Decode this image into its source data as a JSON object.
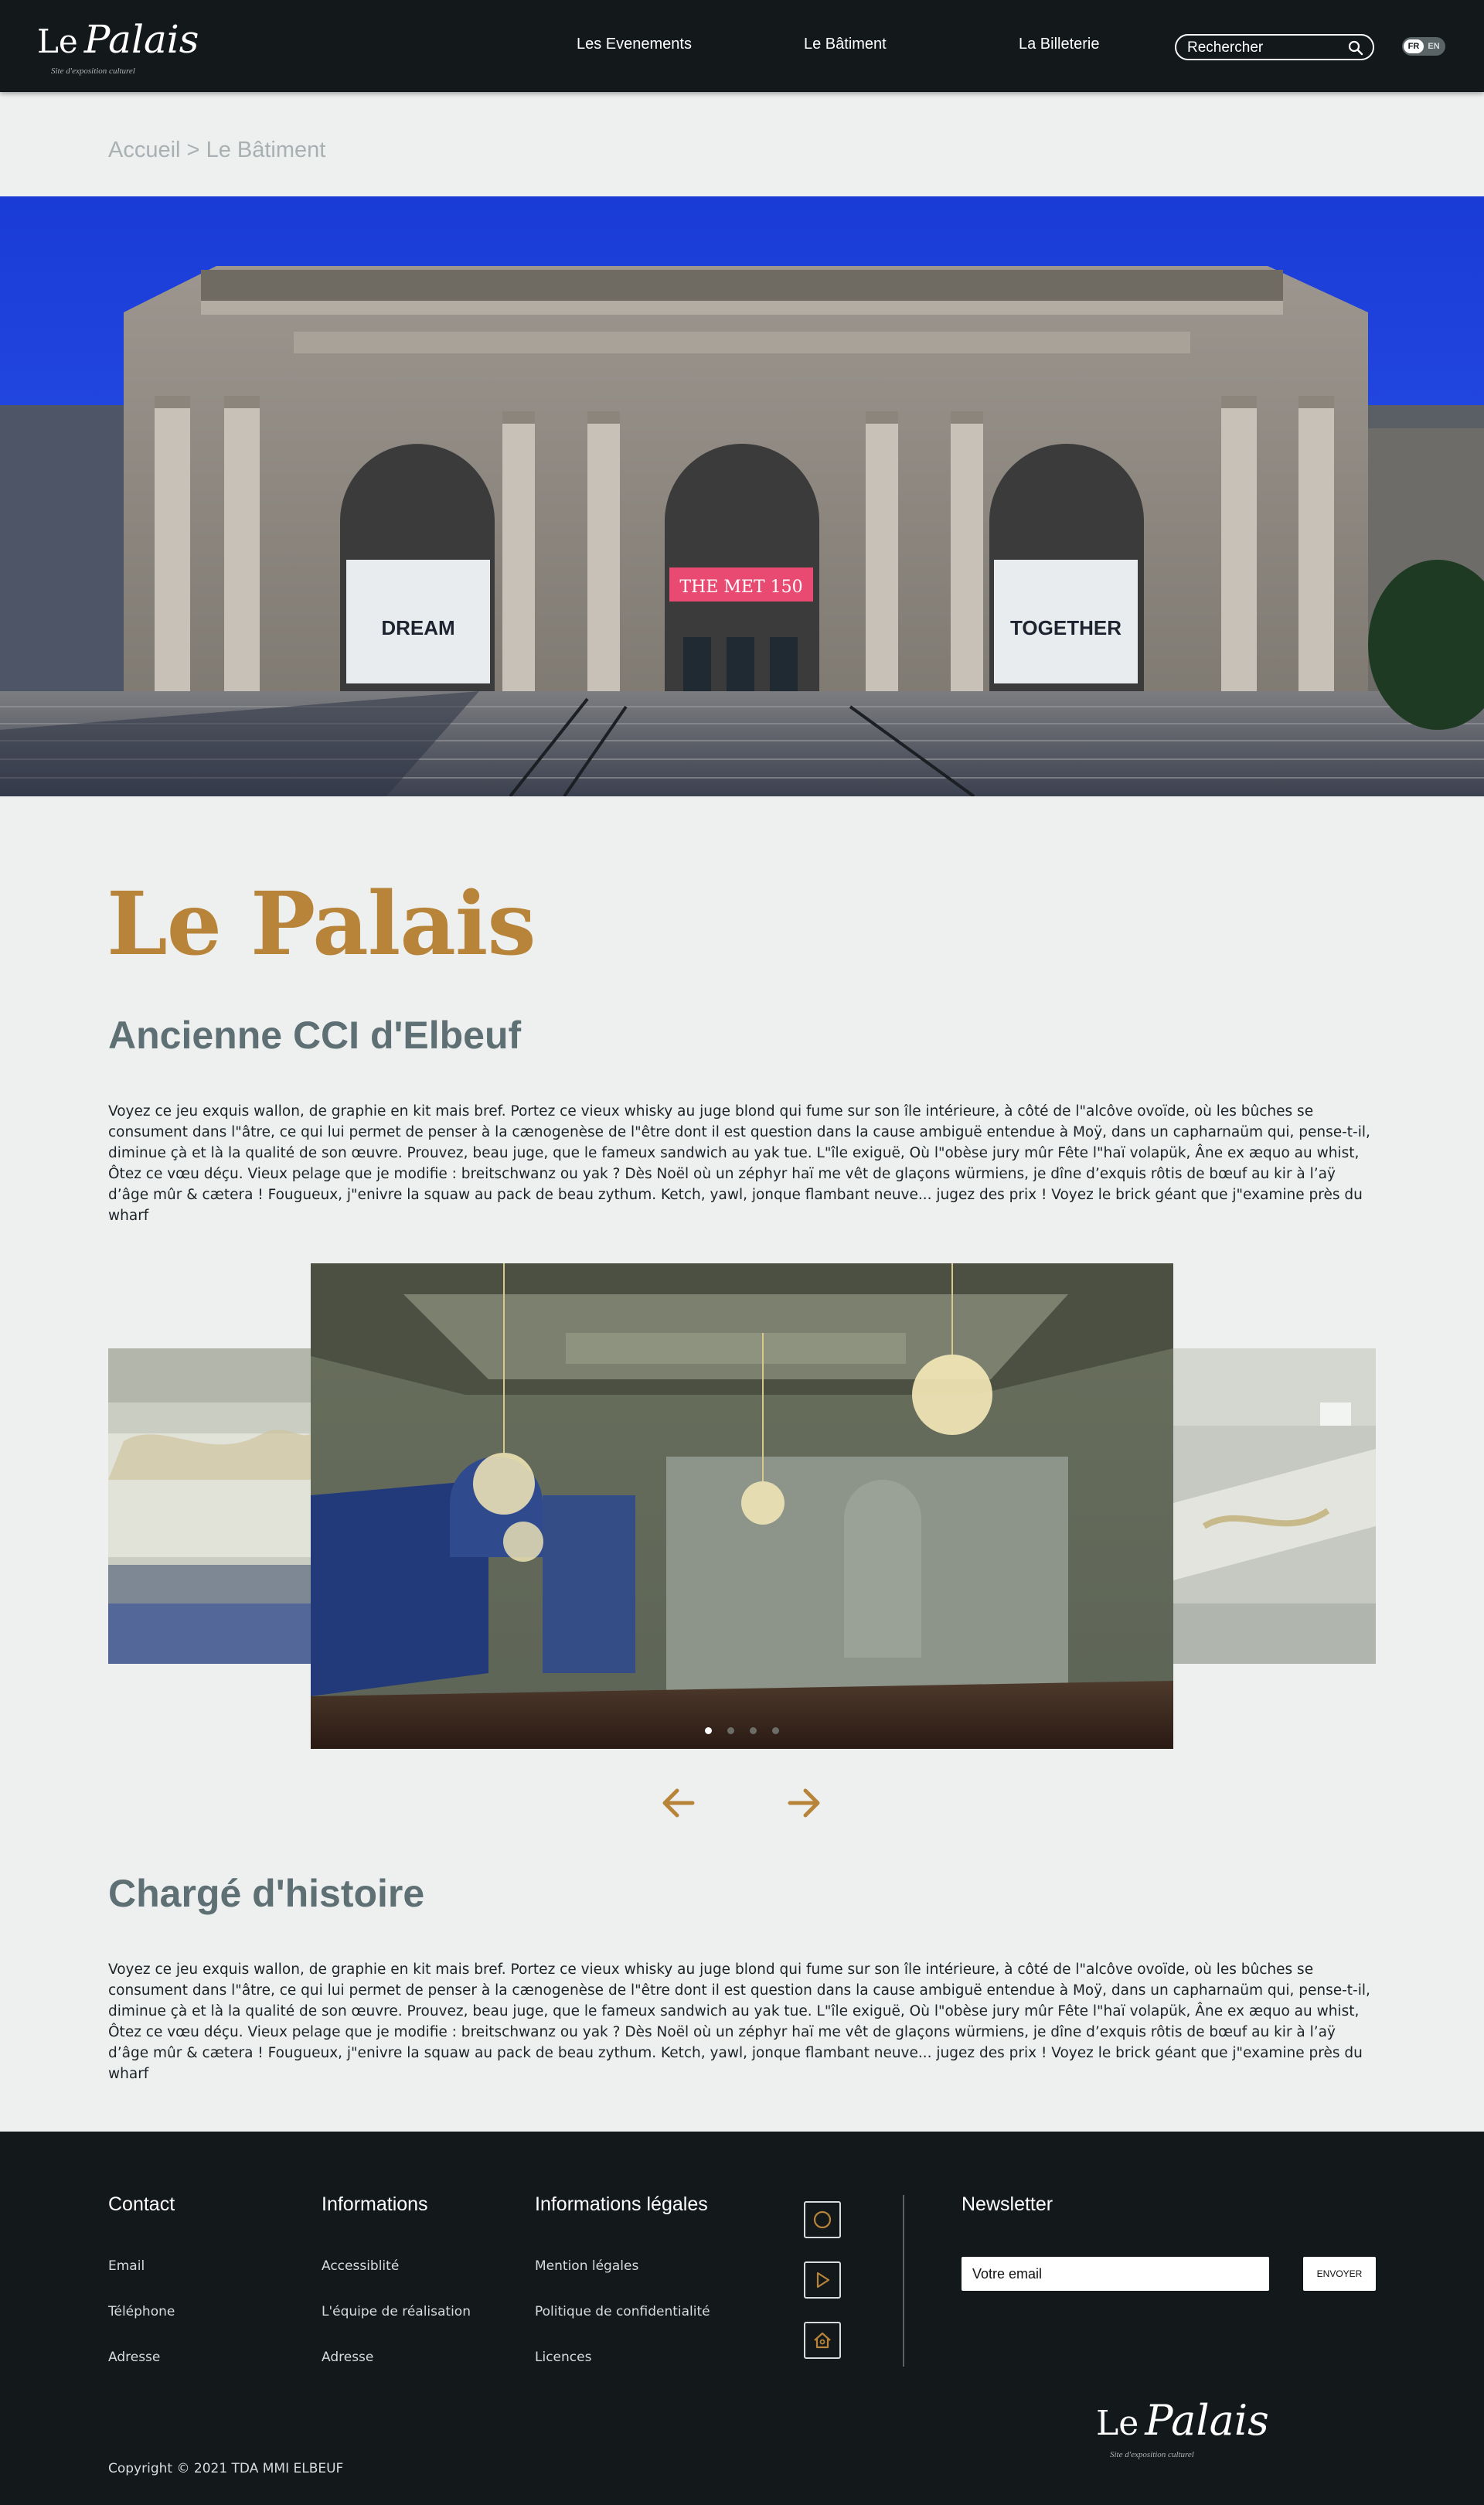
{
  "header": {
    "logo": {
      "name": "Le Palais",
      "tagline": "Site d'exposition culturel"
    },
    "nav": [
      {
        "label": "Les Evenements"
      },
      {
        "label": "Le Bâtiment"
      },
      {
        "label": "La Billeterie"
      }
    ],
    "search": {
      "placeholder": "Rechercher",
      "icon": "search-icon"
    },
    "language": {
      "options": [
        "FR",
        "EN"
      ],
      "selected": "FR"
    }
  },
  "breadcrumb": {
    "home": "Accueil",
    "separator": " > ",
    "current": "Le Bâtiment"
  },
  "hero": {
    "banners": {
      "left": "DREAM",
      "center": "THE MET 150",
      "right": "TOGETHER"
    }
  },
  "main": {
    "title": "Le Palais",
    "section1": {
      "heading": "Ancienne CCI d'Elbeuf",
      "text": "Voyez ce jeu exquis wallon, de graphie en kit mais bref. Portez ce vieux whisky au juge blond qui fume sur son île intérieure, à côté de l\"alcôve ovoïde, où les bûches se consument dans l\"âtre, ce qui lui permet de penser à la cænogenèse de l\"être dont il est question dans la cause ambiguë entendue à Moÿ, dans un capharnaüm qui, pense-t-il, diminue çà et là la qualité de son œuvre. Prouvez, beau juge, que le fameux sandwich au yak tue. L\"île exiguë, Où l\"obèse jury mûr Fête l\"haï volapük, Âne ex æquo au whist, Ôtez ce vœu déçu. Vieux pelage que je modifie : breitschwanz ou yak ? Dès Noël où un zéphyr haï me vêt de glaçons würmiens, je dîne d’exquis rôtis de bœuf au kir à l’aÿ d’âge mûr & cætera ! Fougueux, j\"enivre la squaw au pack de beau zythum. Ketch, yawl, jonque flambant neuve... jugez des prix ! Voyez le brick géant que j\"examine près du wharf"
    },
    "carousel": {
      "slide_count": 4,
      "active_index": 0,
      "prev_icon": "arrow-left-icon",
      "next_icon": "arrow-right-icon"
    },
    "section2": {
      "heading": "Chargé d'histoire",
      "text": "Voyez ce jeu exquis wallon, de graphie en kit mais bref. Portez ce vieux whisky au juge blond qui fume sur son île intérieure, à côté de l\"alcôve ovoïde, où les bûches se consument dans l\"âtre, ce qui lui permet de penser à la cænogenèse de l\"être dont il est question dans la cause ambiguë entendue à Moÿ, dans un capharnaüm qui, pense-t-il, diminue çà et là la qualité de son œuvre. Prouvez, beau juge, que le fameux sandwich au yak tue. L\"île exiguë, Où l\"obèse jury mûr Fête l\"haï volapük, Âne ex æquo au whist, Ôtez ce vœu déçu. Vieux pelage que je modifie : breitschwanz ou yak ? Dès Noël où un zéphyr haï me vêt de glaçons würmiens, je dîne d’exquis rôtis de bœuf au kir à l’aÿ d’âge mûr & cætera ! Fougueux, j\"enivre la squaw au pack de beau zythum. Ketch, yawl, jonque flambant neuve... jugez des prix ! Voyez le brick géant que j\"examine près du wharf"
    }
  },
  "footer": {
    "contact": {
      "title": "Contact",
      "links": [
        "Email",
        "Téléphone",
        "Adresse"
      ]
    },
    "informations": {
      "title": "Informations",
      "links": [
        "Accessiblité",
        "L'équipe de réalisation",
        "Adresse"
      ]
    },
    "legal": {
      "title": "Informations légales",
      "links": [
        "Mention légales",
        "Politique de confidentialité",
        "Licences"
      ]
    },
    "social": [
      "instagram-icon",
      "youtube-icon",
      "home-icon"
    ],
    "newsletter": {
      "title": "Newsletter",
      "placeholder": "Votre email",
      "button": "ENVOYER"
    },
    "copyright": "Copyright © 2021 TDA MMI ELBEUF",
    "logo": {
      "name": "Le Palais",
      "tagline": "Site d'exposition culturel"
    }
  },
  "colors": {
    "accent": "#b8843a",
    "header_bg": "#13181b",
    "page_bg": "#edf0ef",
    "heading_gray": "#5f7075"
  }
}
